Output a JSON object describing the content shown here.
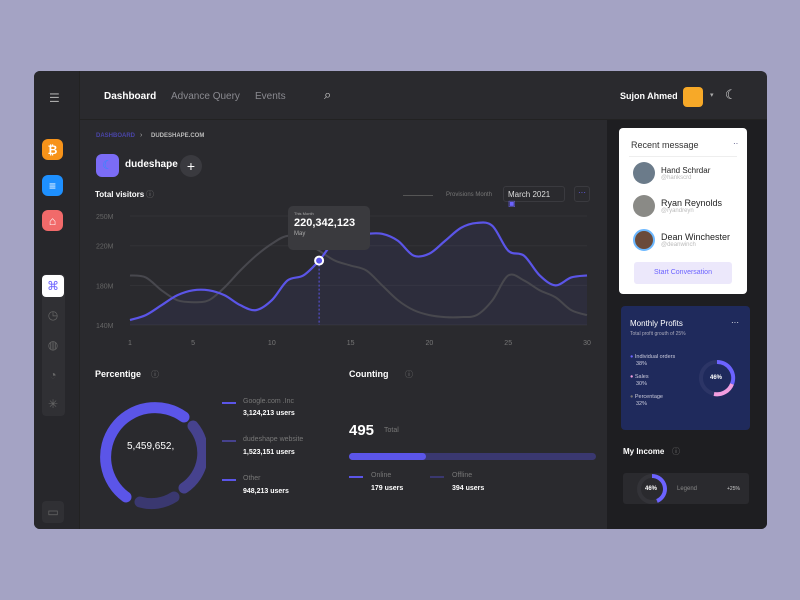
{
  "header": {
    "nav": [
      "Dashboard",
      "Advance Query",
      "Events"
    ],
    "user": "Sujon Ahmed"
  },
  "sidebar": {
    "apps": [
      "bitcoin-icon",
      "list-icon",
      "airbnb-icon"
    ],
    "tools": [
      "command-icon",
      "clock-icon",
      "globe-icon",
      "pie-icon",
      "loader-icon"
    ]
  },
  "breadcrumb": {
    "root": "DASHBOARD",
    "current": "DUDESHAPE.COM"
  },
  "project": {
    "name": "dudeshape"
  },
  "visitors": {
    "title": "Total visitors",
    "legend": "Provisions Month",
    "date": "March 2021",
    "tooltip": {
      "label": "This Month",
      "value": "220,342,123",
      "sub": "May"
    }
  },
  "chart_data": {
    "type": "line",
    "x": [
      1,
      2,
      3,
      4,
      5,
      6,
      7,
      8,
      9,
      10,
      11,
      12,
      13,
      14,
      15,
      16,
      17,
      18,
      19,
      20,
      21,
      22,
      23,
      24,
      25,
      26,
      27,
      28,
      29,
      30
    ],
    "xticks": [
      "1",
      "5",
      "10",
      "15",
      "20",
      "25",
      "30"
    ],
    "yticks": [
      "250M",
      "220M",
      "180M",
      "140M"
    ],
    "ylim": [
      140,
      250
    ],
    "series": [
      {
        "values": [
          145,
          150,
          160,
          170,
          175,
          175,
          170,
          160,
          155,
          165,
          185,
          190,
          205,
          225,
          230,
          232,
          232,
          225,
          210,
          212,
          225,
          238,
          243,
          240,
          215,
          210,
          190,
          180,
          188,
          190
        ],
        "color": "#5b55e8"
      },
      {
        "name": "Provisions Month",
        "values": [
          190,
          188,
          175,
          165,
          163,
          165,
          178,
          195,
          210,
          222,
          230,
          225,
          215,
          205,
          200,
          195,
          180,
          165,
          155,
          150,
          148,
          148,
          150,
          165,
          190,
          185,
          175,
          168,
          155,
          150
        ],
        "color": "#48484e"
      }
    ],
    "highlight": {
      "x": 13,
      "y": 205
    }
  },
  "percentige": {
    "title": "Percentige",
    "total": "5,459,652,",
    "items": [
      {
        "label": "Google.com .Inc",
        "value": "3,124,213 users"
      },
      {
        "label": "dudeshape website",
        "value": "1,523,151 users"
      },
      {
        "label": "Other",
        "value": "948,213 users"
      }
    ]
  },
  "counting": {
    "title": "Counting",
    "total": "495",
    "total_label": "Total",
    "online_fraction": 0.31,
    "online": {
      "label": "Online",
      "value": "179 users"
    },
    "offline": {
      "label": "Offline",
      "value": "394 users"
    }
  },
  "messages": {
    "title": "Recent message",
    "items": [
      {
        "name": "Hand Schrdar",
        "handle": "@hankscrd"
      },
      {
        "name": "Ryan Reynolds",
        "handle": "@ryandreyn"
      },
      {
        "name": "Dean Winchester",
        "handle": "@deanwinch"
      }
    ],
    "button": "Start Conversation"
  },
  "profits": {
    "title": "Monthly Profits",
    "subtitle": "Total profit grouth of 25%",
    "center": "46%",
    "items": [
      {
        "label": "Individual orders",
        "value": "38%",
        "color": "#6c63ff"
      },
      {
        "label": "Sales",
        "value": "30%",
        "color": "#f29ee0"
      },
      {
        "label": "Percentage",
        "value": "32%",
        "color": "#777"
      }
    ]
  },
  "income": {
    "title": "My Income",
    "center": "46%",
    "legend": "Legend",
    "change": "+25%"
  }
}
